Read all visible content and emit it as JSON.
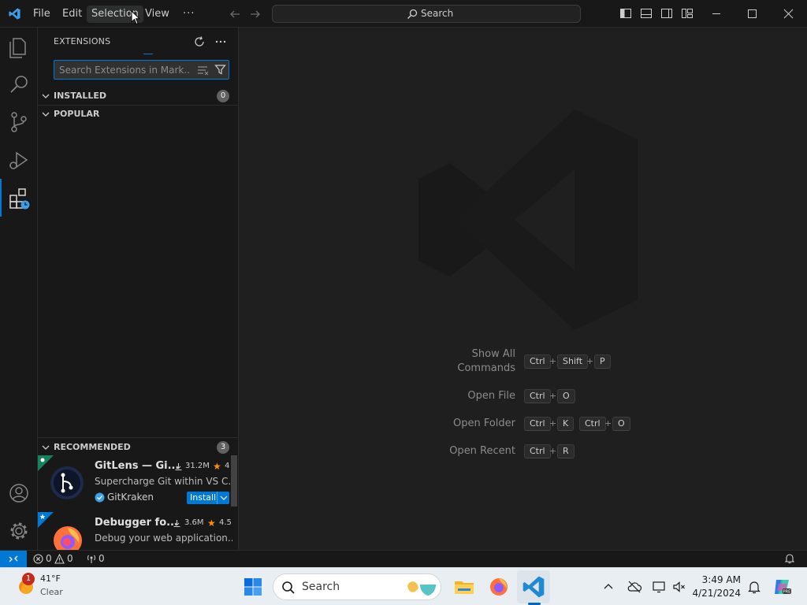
{
  "titlebar": {
    "menu": [
      "File",
      "Edit",
      "Selection",
      "View"
    ],
    "more": "···",
    "search_label": "Search"
  },
  "sidebar": {
    "title": "EXTENSIONS",
    "search_placeholder": "Search Extensions in Mark...",
    "sections": {
      "installed": {
        "label": "INSTALLED",
        "count": "0"
      },
      "popular": {
        "label": "POPULAR"
      },
      "recommended": {
        "label": "RECOMMENDED",
        "count": "3"
      }
    },
    "extensions": [
      {
        "name": "GitLens — Gi...",
        "downloads": "31.2M",
        "rating": "4",
        "description": "Supercharge Git within VS C...",
        "publisher": "GitKraken",
        "install_label": "Install"
      },
      {
        "name": "Debugger fo...",
        "downloads": "3.6M",
        "rating": "4.5",
        "description": "Debug your web application..."
      }
    ]
  },
  "editor": {
    "shortcuts": [
      {
        "label_line1": "Show All",
        "label_line2": "Commands",
        "keys": [
          "Ctrl",
          "Shift",
          "P"
        ]
      },
      {
        "label": "Open File",
        "keys": [
          "Ctrl",
          "O"
        ]
      },
      {
        "label": "Open Folder",
        "keys": [
          "Ctrl",
          "K",
          "Ctrl",
          "O"
        ]
      },
      {
        "label": "Open Recent",
        "keys": [
          "Ctrl",
          "R"
        ]
      }
    ],
    "plus": "+"
  },
  "statusbar": {
    "errors": "0",
    "warnings": "0",
    "ports": "0"
  },
  "taskbar": {
    "weather_temp": "41°F",
    "weather_desc": "Clear",
    "weather_badge": "1",
    "search_label": "Search",
    "time": "3:49 AM",
    "date": "4/21/2024"
  },
  "colors": {
    "accent": "#0078d4",
    "background": "#1f1f1f",
    "sidebar": "#181818"
  }
}
